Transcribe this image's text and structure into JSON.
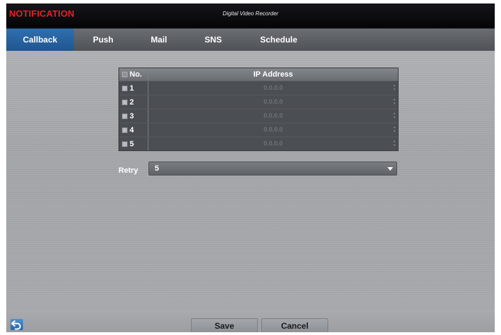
{
  "window": {
    "title": "NOTIFICATION",
    "device_name": "Digital Video Recorder"
  },
  "tabs": [
    {
      "label": "Callback",
      "active": true
    },
    {
      "label": "Push",
      "active": false
    },
    {
      "label": "Mail",
      "active": false
    },
    {
      "label": "SNS",
      "active": false
    },
    {
      "label": "Schedule",
      "active": false
    }
  ],
  "callback_table": {
    "headers": {
      "no": "No.",
      "ip": "IP Address"
    },
    "rows": [
      {
        "no": "1",
        "ip": "0.0.0.0"
      },
      {
        "no": "2",
        "ip": "0.0.0.0"
      },
      {
        "no": "3",
        "ip": "0.0.0.0"
      },
      {
        "no": "4",
        "ip": "0.0.0.0"
      },
      {
        "no": "5",
        "ip": "0.0.0.0"
      }
    ]
  },
  "retry": {
    "label": "Retry",
    "value": "5"
  },
  "footer": {
    "save_label": "Save",
    "cancel_label": "Cancel"
  },
  "colors": {
    "title_red": "#e0222a",
    "active_tab_blue": "#2a63a0"
  },
  "icons": {
    "back": "back-arrow-icon",
    "dropdown": "chevron-down-icon"
  }
}
